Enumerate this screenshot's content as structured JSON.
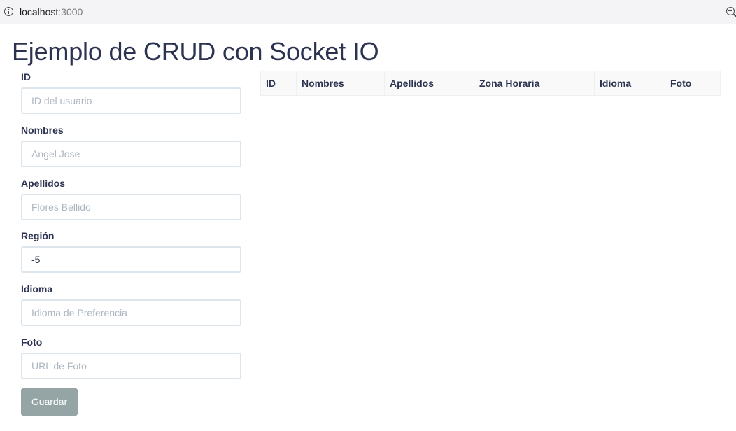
{
  "browser": {
    "url_host": "localhost",
    "url_port": ":3000"
  },
  "page": {
    "title": "Ejemplo de CRUD con Socket IO"
  },
  "form": {
    "fields": [
      {
        "label": "ID",
        "value": "",
        "placeholder": "ID del usuario"
      },
      {
        "label": "Nombres",
        "value": "",
        "placeholder": "Angel Jose"
      },
      {
        "label": "Apellidos",
        "value": "",
        "placeholder": "Flores Bellido"
      },
      {
        "label": "Región",
        "value": "-5",
        "placeholder": ""
      },
      {
        "label": "Idioma",
        "value": "",
        "placeholder": "Idioma de Preferencia"
      },
      {
        "label": "Foto",
        "value": "",
        "placeholder": "URL de Foto"
      }
    ],
    "save_label": "Guardar"
  },
  "table": {
    "columns": [
      "ID",
      "Nombres",
      "Apellidos",
      "Zona Horaria",
      "Idioma",
      "Foto"
    ],
    "rows": []
  },
  "colors": {
    "title_text": "#2c3350",
    "button_bg": "#95a5a6",
    "input_border": "#dce4ec",
    "placeholder": "#acb6c0",
    "address_bar_border": "#c9c3dc"
  }
}
